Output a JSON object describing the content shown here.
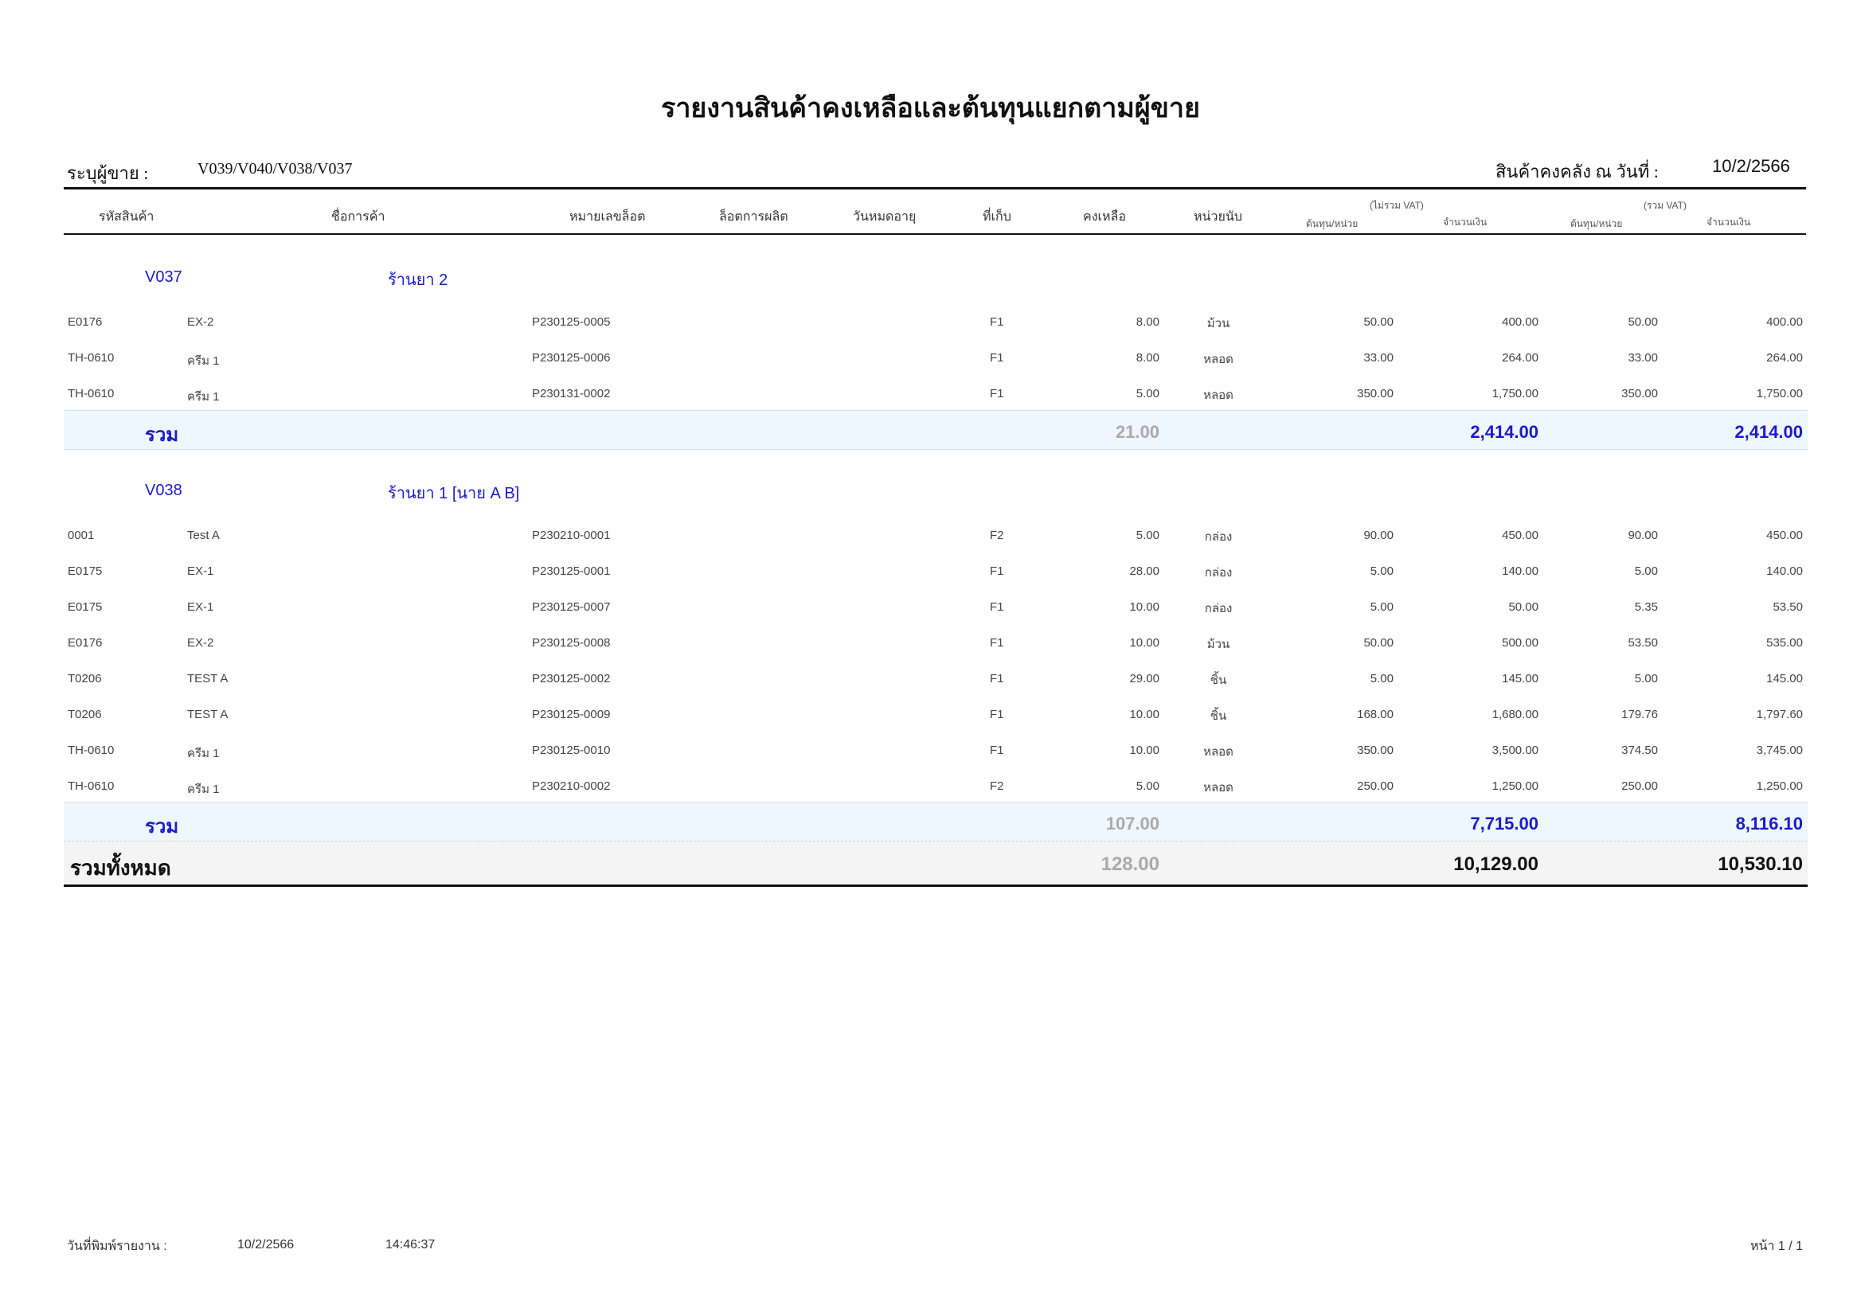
{
  "report": {
    "title": "รายงานสินค้าคงเหลือและต้นทุนแยกตามผู้ขาย",
    "vendor_label": "ระบุผู้ขาย  :",
    "vendor_value": "V039/V040/V038/V037",
    "stock_date_label": "สินค้าคงคลัง ณ วันที่ :",
    "stock_date_value": "10/2/2566"
  },
  "columns": {
    "code": "รหัสสินค้า",
    "name": "ชื่อการค้า",
    "lot_no": "หมายเลขล็อต",
    "mfg_lot": "ล็อตการผลิต",
    "expiry": "วันหมดอายุ",
    "location": "ที่เก็บ",
    "remaining": "คงเหลือ",
    "unit": "หน่วยนับ",
    "excl_vat": "(ไม่รวม VAT)",
    "incl_vat": "(รวม VAT)",
    "cost_per_unit": "ต้นทุน/หน่วย",
    "amount": "จำนวนเงิน"
  },
  "groups": [
    {
      "code": "V037",
      "name": "ร้านยา 2",
      "rows": [
        {
          "code": "E0176",
          "name": "EX-2",
          "lot": "P230125-0005",
          "loc": "F1",
          "qty": "8.00",
          "unit": "ม้วน",
          "cost_ex": "50.00",
          "amt_ex": "400.00",
          "cost_in": "50.00",
          "amt_in": "400.00"
        },
        {
          "code": "TH-0610",
          "name": "ครีม 1",
          "lot": "P230125-0006",
          "loc": "F1",
          "qty": "8.00",
          "unit": "หลอด",
          "cost_ex": "33.00",
          "amt_ex": "264.00",
          "cost_in": "33.00",
          "amt_in": "264.00"
        },
        {
          "code": "TH-0610",
          "name": "ครีม 1",
          "lot": "P230131-0002",
          "loc": "F1",
          "qty": "5.00",
          "unit": "หลอด",
          "cost_ex": "350.00",
          "amt_ex": "1,750.00",
          "cost_in": "350.00",
          "amt_in": "1,750.00"
        }
      ],
      "sum_label": "รวม",
      "sum_qty": "21.00",
      "sum_amt_ex": "2,414.00",
      "sum_amt_in": "2,414.00"
    },
    {
      "code": "V038",
      "name": "ร้านยา 1 [นาย A B]",
      "rows": [
        {
          "code": "0001",
          "name": "Test A",
          "lot": "P230210-0001",
          "loc": "F2",
          "qty": "5.00",
          "unit": "กล่อง",
          "cost_ex": "90.00",
          "amt_ex": "450.00",
          "cost_in": "90.00",
          "amt_in": "450.00"
        },
        {
          "code": "E0175",
          "name": "EX-1",
          "lot": "P230125-0001",
          "loc": "F1",
          "qty": "28.00",
          "unit": "กล่อง",
          "cost_ex": "5.00",
          "amt_ex": "140.00",
          "cost_in": "5.00",
          "amt_in": "140.00"
        },
        {
          "code": "E0175",
          "name": "EX-1",
          "lot": "P230125-0007",
          "loc": "F1",
          "qty": "10.00",
          "unit": "กล่อง",
          "cost_ex": "5.00",
          "amt_ex": "50.00",
          "cost_in": "5.35",
          "amt_in": "53.50"
        },
        {
          "code": "E0176",
          "name": "EX-2",
          "lot": "P230125-0008",
          "loc": "F1",
          "qty": "10.00",
          "unit": "ม้วน",
          "cost_ex": "50.00",
          "amt_ex": "500.00",
          "cost_in": "53.50",
          "amt_in": "535.00"
        },
        {
          "code": "T0206",
          "name": "TEST A",
          "lot": "P230125-0002",
          "loc": "F1",
          "qty": "29.00",
          "unit": "ชิ้น",
          "cost_ex": "5.00",
          "amt_ex": "145.00",
          "cost_in": "5.00",
          "amt_in": "145.00"
        },
        {
          "code": "T0206",
          "name": "TEST A",
          "lot": "P230125-0009",
          "loc": "F1",
          "qty": "10.00",
          "unit": "ชิ้น",
          "cost_ex": "168.00",
          "amt_ex": "1,680.00",
          "cost_in": "179.76",
          "amt_in": "1,797.60"
        },
        {
          "code": "TH-0610",
          "name": "ครีม 1",
          "lot": "P230125-0010",
          "loc": "F1",
          "qty": "10.00",
          "unit": "หลอด",
          "cost_ex": "350.00",
          "amt_ex": "3,500.00",
          "cost_in": "374.50",
          "amt_in": "3,745.00"
        },
        {
          "code": "TH-0610",
          "name": "ครีม 1",
          "lot": "P230210-0002",
          "loc": "F2",
          "qty": "5.00",
          "unit": "หลอด",
          "cost_ex": "250.00",
          "amt_ex": "1,250.00",
          "cost_in": "250.00",
          "amt_in": "1,250.00"
        }
      ],
      "sum_label": "รวม",
      "sum_qty": "107.00",
      "sum_amt_ex": "7,715.00",
      "sum_amt_in": "8,116.10"
    }
  ],
  "grand_total": {
    "label": "รวมทั้งหมด",
    "qty": "128.00",
    "amt_ex": "10,129.00",
    "amt_in": "10,530.10"
  },
  "footer": {
    "print_label": "วันที่พิมพ์รายงาน :",
    "print_date": "10/2/2566",
    "print_time": "14:46:37",
    "page": "หน้า 1 / 1"
  }
}
